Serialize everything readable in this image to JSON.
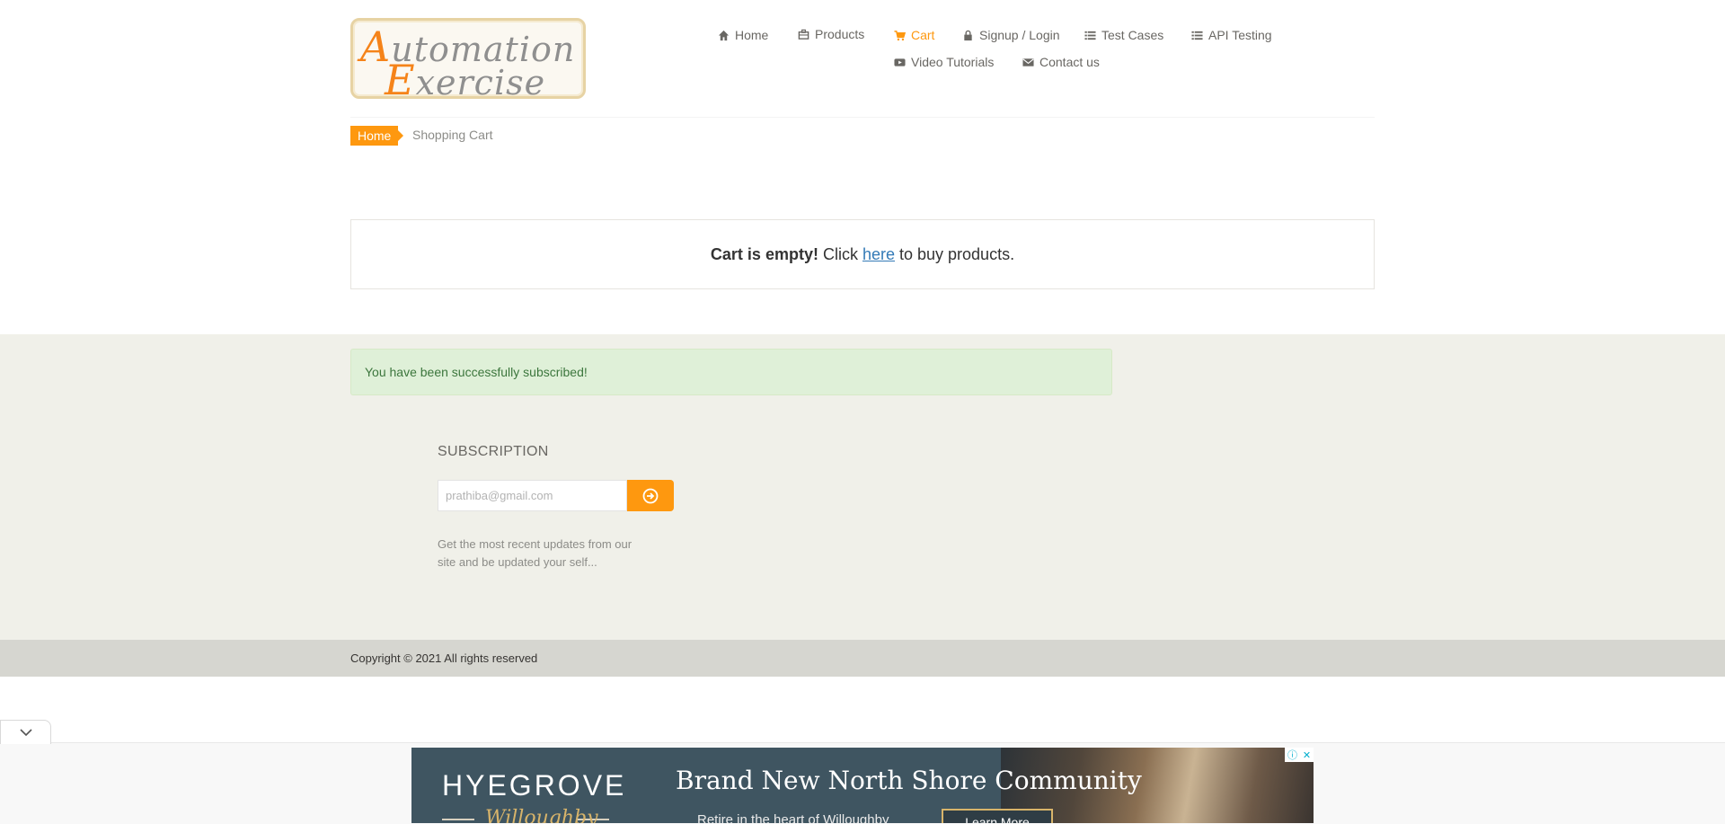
{
  "brand": {
    "logo_line1_cap": "A",
    "logo_line1_rest": "utomation",
    "logo_line2_cap": "E",
    "logo_line2_rest": "xercise"
  },
  "nav": {
    "items": [
      {
        "label": "Home",
        "icon": "home-icon"
      },
      {
        "label": "Products",
        "icon": "products-icon"
      },
      {
        "label": "Cart",
        "icon": "cart-icon",
        "active": true
      },
      {
        "label": "Signup / Login",
        "icon": "lock-icon"
      },
      {
        "label": "Test Cases",
        "icon": "list-icon"
      },
      {
        "label": "API Testing",
        "icon": "list-icon"
      },
      {
        "label": "Video Tutorials",
        "icon": "youtube-icon"
      },
      {
        "label": "Contact us",
        "icon": "envelope-icon"
      }
    ]
  },
  "breadcrumb": {
    "home": "Home",
    "current": "Shopping Cart"
  },
  "cart": {
    "empty_bold": "Cart is empty!",
    "click": "Click",
    "link": "here",
    "tail": "to buy products."
  },
  "alert": {
    "message": "You have been successfully subscribed!"
  },
  "subscription": {
    "title": "SUBSCRIPTION",
    "placeholder": "prathiba@gmail.com",
    "description": "Get the most recent updates from our site and be updated your self..."
  },
  "footer": {
    "copyright": "Copyright © 2021 All rights reserved"
  },
  "ad": {
    "brand": "HYEGROVE",
    "sub_brand": "Willoughby",
    "headline": "Brand New North Shore Community",
    "tagline": "Retire in the heart of Willoughby",
    "cta": "Learn More",
    "info_icon": "ⓘ",
    "close_icon": "✕"
  },
  "colors": {
    "accent": "#fe980f",
    "link": "#337ab7",
    "alert_bg": "#dff0d8",
    "footer_bg": "#f0f0e9"
  }
}
